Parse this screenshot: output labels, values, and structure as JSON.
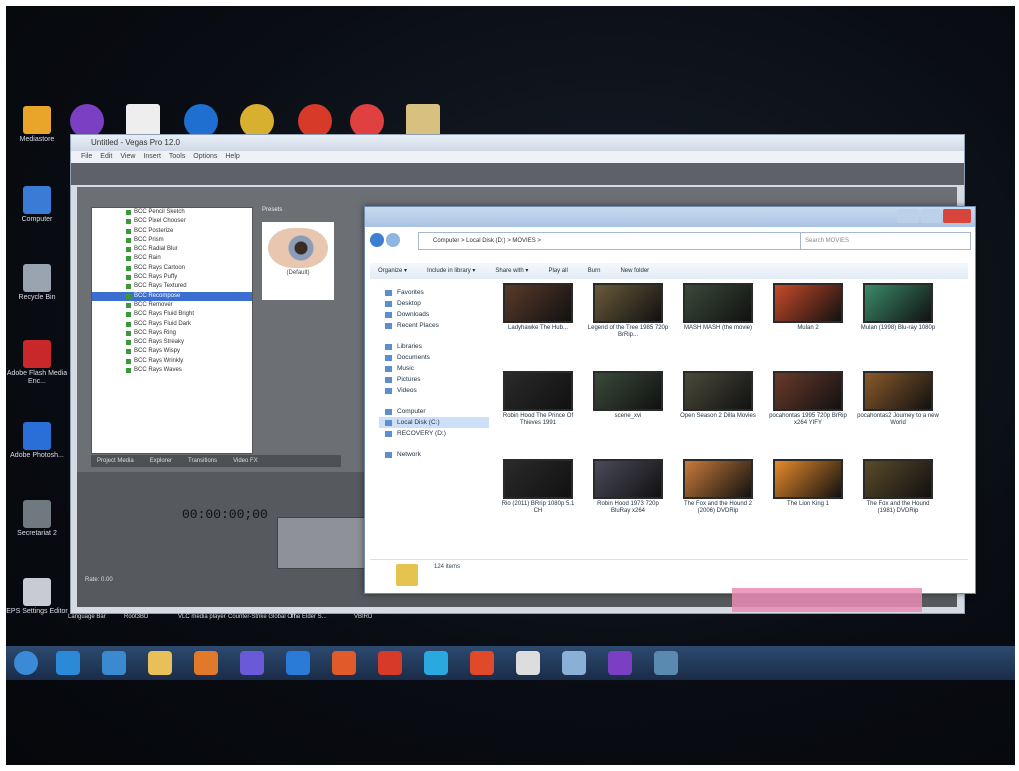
{
  "desktop_icons": [
    {
      "label": "Mediastore",
      "color": "#e8a52a"
    },
    {
      "label": "Computer",
      "color": "#3a7bd5"
    },
    {
      "label": "Recycle Bin",
      "color": "#9aa4b0"
    },
    {
      "label": "Adobe Flash Media Enc...",
      "color": "#c8282a"
    },
    {
      "label": "Adobe Photosh...",
      "color": "#2a6fd8"
    },
    {
      "label": "Secretariat 2",
      "color": "#707880"
    },
    {
      "label": "EPS Settings Editor",
      "color": "#c8ccd2"
    }
  ],
  "top_icons": [
    {
      "name": "media-icon",
      "color": "#7a3fc2"
    },
    {
      "name": "document-icon",
      "color": "#eeeeee"
    },
    {
      "name": "browser-icon",
      "color": "#1e6fd0"
    },
    {
      "name": "app-icon",
      "color": "#d8b030"
    },
    {
      "name": "chrome-icon",
      "color": "#d83a2a"
    },
    {
      "name": "flash-icon",
      "color": "#e04040"
    },
    {
      "name": "archive-icon",
      "color": "#d8c080"
    }
  ],
  "vegas": {
    "title": "Untitled - Vegas Pro 12.0",
    "menu": [
      "File",
      "Edit",
      "View",
      "Insert",
      "Tools",
      "Options",
      "Help"
    ],
    "presets_label": "Presets",
    "preset_caption": "(Default)",
    "fx_list": [
      "BCC Pencil Sketch",
      "BCC Pixel Chooser",
      "BCC Posterize",
      "BCC Prism",
      "BCC Radial Blur",
      "BCC Rain",
      "BCC Rays Cartoon",
      "BCC Rays Puffy",
      "BCC Rays Textured",
      "BCC Recompose",
      "BCC Remover",
      "BCC Rays Fluid Bright",
      "BCC Rays Fluid Dark",
      "BCC Rays Ring",
      "BCC Rays Streaky",
      "BCC Rays Wispy",
      "BCC Rays Wrinkly",
      "BCC Rays Waves"
    ],
    "selected_index": 9,
    "tabs": [
      "Project Media",
      "Explorer",
      "Transitions",
      "Video FX"
    ],
    "timecode": "00:00:00;00",
    "rate": "Rate: 0.00"
  },
  "explorer": {
    "address": "Computer  >  Local Disk (D:)  >  MOVIES  >",
    "search_placeholder": "Search MOVIES",
    "commands": [
      "Organize ▾",
      "Include in library ▾",
      "Share with ▾",
      "Play all",
      "Burn",
      "New folder"
    ],
    "nav": {
      "favorites": [
        "Favorites",
        "Desktop",
        "Downloads",
        "Recent Places"
      ],
      "libraries": [
        "Libraries",
        "Documents",
        "Music",
        "Pictures",
        "Videos"
      ],
      "computer": [
        "Computer",
        "Local Disk (C:)",
        "RECOVERY (D:)"
      ],
      "network": [
        "Network"
      ]
    },
    "files": [
      {
        "label": "Ladyhawke The Hub...",
        "color": "#5a3a2a"
      },
      {
        "label": "Legend of the Tree 1985 720p BrRip...",
        "color": "#6a5a3a"
      },
      {
        "label": "MASH MASH (the movie)",
        "color": "#3a4a3a"
      },
      {
        "label": "Mulan 2",
        "color": "#c84a2a"
      },
      {
        "label": "Mulan (1998) Blu-ray 1080p",
        "color": "#3a8a6a"
      },
      {
        "label": "Robin Hood The Prince Of Thieves 1991",
        "color": "#2a2a2a"
      },
      {
        "label": "scene_xvi",
        "color": "#3a4a3a"
      },
      {
        "label": "Open Season 2 Dilla Movies",
        "color": "#4a4a3a"
      },
      {
        "label": "pocahontas 1995 720p BrRip x264 YIFY",
        "color": "#6a3a2a"
      },
      {
        "label": "pocahontas2 Journey to a new World",
        "color": "#8a5a2a"
      },
      {
        "label": "Rio (2011) BRrip 1080p 5.1 CH",
        "color": "#2a2a2a"
      },
      {
        "label": "Robin Hood 1973 720p BluRay x264",
        "color": "#4a4a5a"
      },
      {
        "label": "The Fox and the Hound 2 (2006) DVDRip",
        "color": "#c87a3a"
      },
      {
        "label": "The Lion King 1",
        "color": "#e88a2a"
      },
      {
        "label": "The Fox and the Hound (1981) DVDRip",
        "color": "#5a4a2a"
      }
    ],
    "item_count": "124 items"
  },
  "taskbar_labels": [
    "Language Bar",
    "Root3BD",
    "VLC media player",
    "Counter-Strike Global Off...",
    "The Elder S...",
    "VBIRD"
  ],
  "taskbar_icons": [
    "#2a8ad8",
    "#3a8ad0",
    "#e8c05a",
    "#e07a2a",
    "#6a5ad8",
    "#2a7ad8",
    "#e05a2a",
    "#d83a2a",
    "#2aa8e0",
    "#e04a2a",
    "#dddddd",
    "#8ab0d8",
    "#7a3fc2",
    "#5a8ab0"
  ]
}
